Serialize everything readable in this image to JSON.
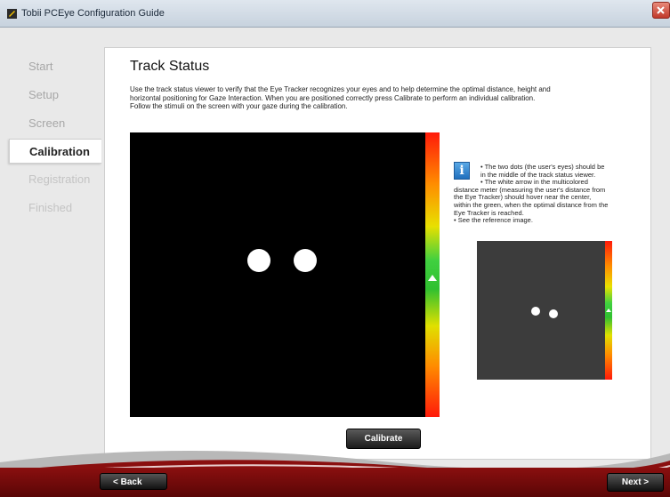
{
  "window": {
    "title": "Tobii PCEye Configuration Guide"
  },
  "sidebar": {
    "items": [
      {
        "label": "Start",
        "state": "done"
      },
      {
        "label": "Setup",
        "state": "done"
      },
      {
        "label": "Screen",
        "state": "done"
      },
      {
        "label": "Calibration",
        "state": "active"
      },
      {
        "label": "Registration",
        "state": "pending"
      },
      {
        "label": "Finished",
        "state": "pending"
      }
    ]
  },
  "main": {
    "title": "Track Status",
    "description": [
      "Use the track status viewer to verify that the Eye Tracker recognizes your eyes and to help determine the optimal distance, height and",
      "horizontal positioning for Gaze Interaction. When you are positioned correctly press Calibrate to perform an individual calibration.",
      "Follow the stimuli on the screen with your gaze during the calibration."
    ],
    "info": {
      "icon": "info-icon",
      "lines": [
        "• The two dots (the user's eyes) should be",
        "in the middle of the track status viewer.",
        "• The white arrow in the multicolored",
        "distance meter (measuring the user's distance from",
        "the Eye Tracker) should hover near the center,",
        "within the green, when the optimal distance from the",
        "Eye Tracker is reached.",
        "• See the reference image."
      ]
    },
    "calibrate_label": "Calibrate"
  },
  "footer": {
    "back_label": "< Back",
    "next_label": "Next >"
  },
  "colors": {
    "accent_red": "#8a0f0f",
    "meter_green": "#40d040"
  }
}
